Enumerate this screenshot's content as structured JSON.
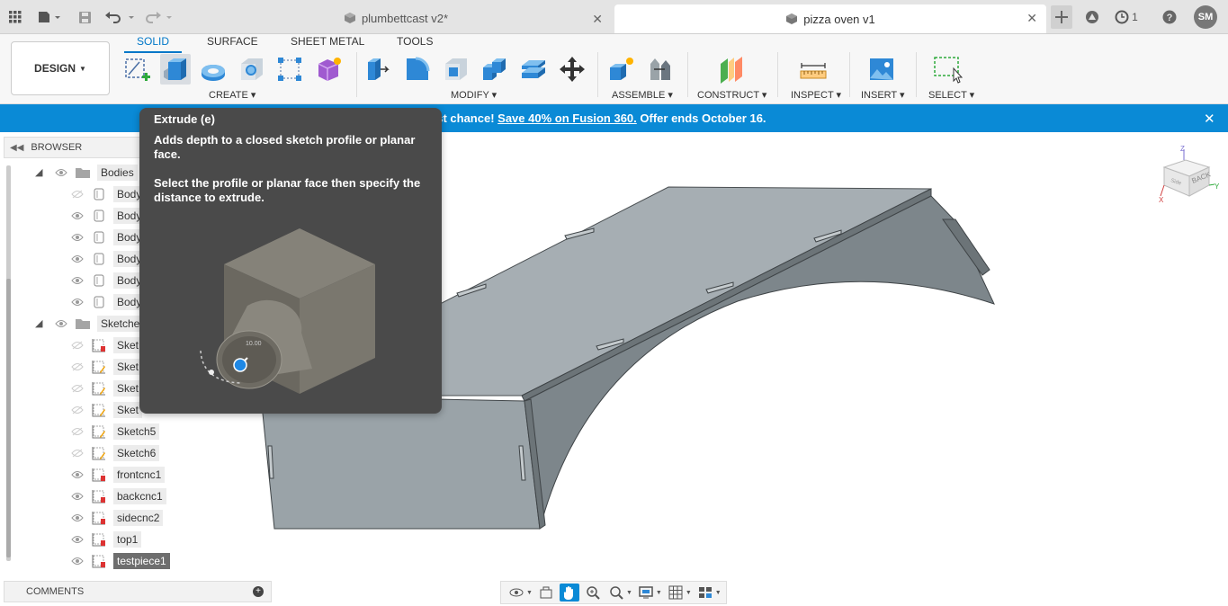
{
  "tabs": [
    {
      "title": "plumbettcast v2*",
      "active": false
    },
    {
      "title": "pizza oven v1",
      "active": true
    }
  ],
  "header": {
    "jobs_count": "1",
    "user_initials": "SM"
  },
  "toolbar": {
    "workspace_button": "DESIGN",
    "workspace_tabs": [
      "SOLID",
      "SURFACE",
      "SHEET METAL",
      "TOOLS"
    ],
    "groups": [
      "CREATE",
      "MODIFY",
      "ASSEMBLE",
      "CONSTRUCT",
      "INSPECT",
      "INSERT",
      "SELECT"
    ]
  },
  "banner": {
    "text_before": "ast chance! ",
    "link": "Save 40% on Fusion 360.",
    "text_after": " Offer ends October 16.",
    "close": "✕"
  },
  "browser": {
    "title": "BROWSER",
    "bodies_folder": "Bodies",
    "bodies": [
      "Body",
      "Body",
      "Body",
      "Body",
      "Body",
      "Body"
    ],
    "sketches_folder": "Sketche",
    "sketches": [
      {
        "name": "Sket",
        "visible": false
      },
      {
        "name": "Sket",
        "visible": false
      },
      {
        "name": "Sket",
        "visible": false
      },
      {
        "name": "Sket",
        "visible": false
      },
      {
        "name": "Sketch5",
        "visible": false
      },
      {
        "name": "Sketch6",
        "visible": false
      },
      {
        "name": "frontcnc1",
        "visible": true
      },
      {
        "name": "backcnc1",
        "visible": true
      },
      {
        "name": "sidecnc2",
        "visible": true
      },
      {
        "name": "top1",
        "visible": true
      },
      {
        "name": "testpiece1",
        "visible": true,
        "selected": true
      }
    ]
  },
  "comments": {
    "title": "COMMENTS"
  },
  "tooltip": {
    "title": "Extrude (e)",
    "p1": "Adds depth to a closed sketch profile or planar face.",
    "p2": "Select the profile or planar face then specify the distance to extrude.",
    "dial_value": "10.00"
  },
  "viewcube": {
    "face_label": "BACK",
    "side_label": "Side",
    "axis_z": "Z",
    "axis_x": "X",
    "axis_y": "Y"
  },
  "colors": {
    "accent": "#0077c8",
    "banner": "#0a8ad6",
    "tooltip_bg": "#4a4a4a",
    "model": "#9aa3a8"
  }
}
